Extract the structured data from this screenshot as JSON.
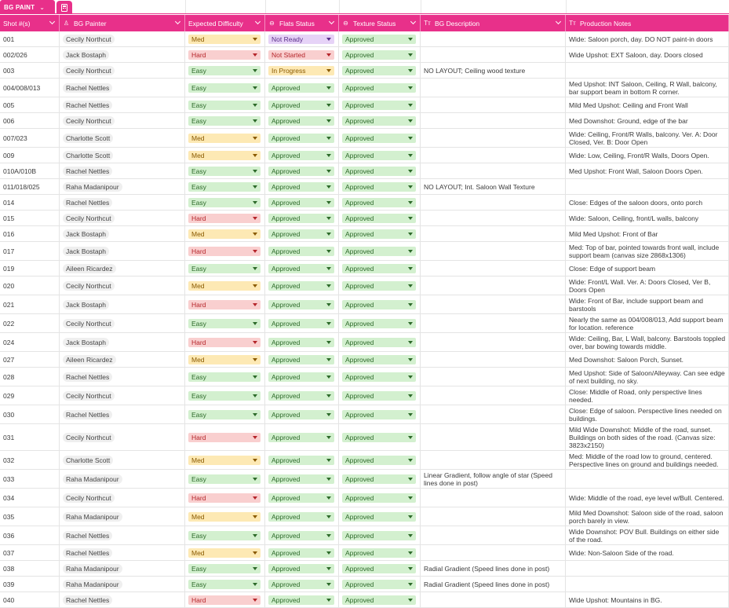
{
  "sheet": {
    "tab_label": "BG PAINT",
    "tab_chevron": "⌄",
    "tab_icon": "calculator-icon"
  },
  "colors": {
    "accent": "#e8308a",
    "easy_bg": "#d3f0cf",
    "easy_fg": "#2d6a2a",
    "med_bg": "#fde9b4",
    "med_fg": "#8a5a00",
    "hard_bg": "#f9cfcf",
    "hard_fg": "#b5252a",
    "approved_bg": "#d3f0cf",
    "approved_fg": "#2d6a2a",
    "notready_bg": "#e6d3f7",
    "notready_fg": "#5a2f8a",
    "notstarted_bg": "#f9cfcf",
    "notstarted_fg": "#b5252a",
    "inprogress_bg": "#fde9b4",
    "inprogress_fg": "#8a5a00"
  },
  "columns": [
    {
      "key": "shot",
      "label": "Shot #(s)",
      "icon": "",
      "icon_name": "",
      "chevron": true
    },
    {
      "key": "painter",
      "label": "BG Painter",
      "icon": "♙",
      "icon_name": "person-icon",
      "chevron": true
    },
    {
      "key": "difficulty",
      "label": "Expected Difficulty",
      "icon": "",
      "icon_name": "",
      "chevron": true
    },
    {
      "key": "flats",
      "label": "Flats Status",
      "icon": "⊖",
      "icon_name": "status-icon",
      "chevron": true
    },
    {
      "key": "texture",
      "label": "Texture Status",
      "icon": "⊖",
      "icon_name": "status-icon",
      "chevron": true
    },
    {
      "key": "desc",
      "label": "BG Description",
      "icon": "Tт",
      "icon_name": "text-icon",
      "chevron": true
    },
    {
      "key": "notes",
      "label": "Production Notes",
      "icon": "Tт",
      "icon_name": "text-icon",
      "chevron": false
    }
  ],
  "rows": [
    {
      "shot": "001",
      "painter": "Cecily Northcut",
      "difficulty": "Med",
      "flats": "Not Ready",
      "texture": "Approved",
      "desc": "",
      "notes": "Wide: Saloon porch, day. DO NOT paint-in doors"
    },
    {
      "shot": "002/026",
      "painter": "Jack Bostaph",
      "difficulty": "Hard",
      "flats": "Not Started",
      "texture": "Approved",
      "desc": "",
      "notes": "Wide Upshot: EXT Saloon, day. Doors closed"
    },
    {
      "shot": "003",
      "painter": "Cecily Northcut",
      "difficulty": "Easy",
      "flats": "In Progress",
      "texture": "Approved",
      "desc": "NO LAYOUT; Ceiling wood texture",
      "notes": ""
    },
    {
      "shot": "004/008/013",
      "painter": "Rachel Nettles",
      "difficulty": "Easy",
      "flats": "Approved",
      "texture": "Approved",
      "desc": "",
      "notes": "Med Upshot: INT Saloon, Ceiling, R Wall, balcony, bar support beam in bottom R corner."
    },
    {
      "shot": "005",
      "painter": "Rachel Nettles",
      "difficulty": "Easy",
      "flats": "Approved",
      "texture": "Approved",
      "desc": "",
      "notes": "Mild Med Upshot: Ceiling and Front Wall"
    },
    {
      "shot": "006",
      "painter": "Cecily Northcut",
      "difficulty": "Easy",
      "flats": "Approved",
      "texture": "Approved",
      "desc": "",
      "notes": "Med Downshot: Ground, edge of the bar"
    },
    {
      "shot": "007/023",
      "painter": "Charlotte Scott",
      "difficulty": "Med",
      "flats": "Approved",
      "texture": "Approved",
      "desc": "",
      "notes": "Wide: Ceiling, Front/R Walls, balcony. Ver. A: Door Closed, Ver. B: Door Open"
    },
    {
      "shot": "009",
      "painter": "Charlotte Scott",
      "difficulty": "Med",
      "flats": "Approved",
      "texture": "Approved",
      "desc": "",
      "notes": "Wide: Low, Ceiling, Front/R Walls, Doors Open."
    },
    {
      "shot": "010A/010B",
      "painter": "Rachel Nettles",
      "difficulty": "Easy",
      "flats": "Approved",
      "texture": "Approved",
      "desc": "",
      "notes": "Med Upshot: Front Wall, Saloon Doors Open."
    },
    {
      "shot": "011/018/025",
      "painter": "Raha Madanipour",
      "difficulty": "Easy",
      "flats": "Approved",
      "texture": "Approved",
      "desc": "NO LAYOUT; Int. Saloon Wall Texture",
      "notes": ""
    },
    {
      "shot": "014",
      "painter": "Rachel Nettles",
      "difficulty": "Easy",
      "flats": "Approved",
      "texture": "Approved",
      "desc": "",
      "notes": "Close: Edges of the saloon doors, onto porch"
    },
    {
      "shot": "015",
      "painter": "Cecily Northcut",
      "difficulty": "Hard",
      "flats": "Approved",
      "texture": "Approved",
      "desc": "",
      "notes": "Wide: Saloon, Ceiling, front/L walls, balcony"
    },
    {
      "shot": "016",
      "painter": "Jack Bostaph",
      "difficulty": "Med",
      "flats": "Approved",
      "texture": "Approved",
      "desc": "",
      "notes": "Mild Med Upshot: Front of Bar"
    },
    {
      "shot": "017",
      "painter": "Jack Bostaph",
      "difficulty": "Hard",
      "flats": "Approved",
      "texture": "Approved",
      "desc": "",
      "notes": "Med: Top of bar, pointed towards front wall, include support beam (canvas size 2868x1306)"
    },
    {
      "shot": "019",
      "painter": "Aileen Ricardez",
      "difficulty": "Easy",
      "flats": "Approved",
      "texture": "Approved",
      "desc": "",
      "notes": "Close: Edge of support beam"
    },
    {
      "shot": "020",
      "painter": "Cecily Northcut",
      "difficulty": "Med",
      "flats": "Approved",
      "texture": "Approved",
      "desc": "",
      "notes": "Wide: Front/L Wall. Ver. A: Doors Closed, Ver B, Doors Open"
    },
    {
      "shot": "021",
      "painter": "Jack Bostaph",
      "difficulty": "Hard",
      "flats": "Approved",
      "texture": "Approved",
      "desc": "",
      "notes": "Wide: Front of Bar, include support beam and barstools"
    },
    {
      "shot": "022",
      "painter": "Cecily Northcut",
      "difficulty": "Easy",
      "flats": "Approved",
      "texture": "Approved",
      "desc": "",
      "notes": "Nearly the same as 004/008/013, Add support beam for location. reference"
    },
    {
      "shot": "024",
      "painter": "Jack Bostaph",
      "difficulty": "Hard",
      "flats": "Approved",
      "texture": "Approved",
      "desc": "",
      "notes": "Wide: Ceiling, Bar, L Wall, balcony. Barstools toppled over, bar bowing towards middle."
    },
    {
      "shot": "027",
      "painter": "Aileen Ricardez",
      "difficulty": "Med",
      "flats": "Approved",
      "texture": "Approved",
      "desc": "",
      "notes": "Med Downshot: Saloon Porch, Sunset."
    },
    {
      "shot": "028",
      "painter": "Rachel Nettles",
      "difficulty": "Easy",
      "flats": "Approved",
      "texture": "Approved",
      "desc": "",
      "notes": "Med Upshot: Side of Saloon/Alleyway. Can see edge of next building, no sky."
    },
    {
      "shot": "029",
      "painter": "Cecily Northcut",
      "difficulty": "Easy",
      "flats": "Approved",
      "texture": "Approved",
      "desc": "",
      "notes": "Close: Middle of Road, only perspective lines needed."
    },
    {
      "shot": "030",
      "painter": "Rachel Nettles",
      "difficulty": "Easy",
      "flats": "Approved",
      "texture": "Approved",
      "desc": "",
      "notes": "Close: Edge of saloon. Perspective lines needed on buildings."
    },
    {
      "shot": "031",
      "painter": "Cecily Northcut",
      "difficulty": "Hard",
      "flats": "Approved",
      "texture": "Approved",
      "desc": "",
      "notes": "Mild Wide Downshot: Middle of the road, sunset. Buildings on both sides of the road. (Canvas size: 3823x2150)"
    },
    {
      "shot": "032",
      "painter": "Charlotte Scott",
      "difficulty": "Med",
      "flats": "Approved",
      "texture": "Approved",
      "desc": "",
      "notes": "Med: Middle of the road low to ground, centered. Perspective lines on ground and buildings needed."
    },
    {
      "shot": "033",
      "painter": "Raha Madanipour",
      "difficulty": "Easy",
      "flats": "Approved",
      "texture": "Approved",
      "desc": "Linear Gradient, follow angle of star (Speed lines done in post)",
      "notes": ""
    },
    {
      "shot": "034",
      "painter": "Cecily Northcut",
      "difficulty": "Hard",
      "flats": "Approved",
      "texture": "Approved",
      "desc": "",
      "notes": "Wide: Middle of the road, eye level w/Bull. Centered."
    },
    {
      "shot": "035",
      "painter": "Raha Madanipour",
      "difficulty": "Med",
      "flats": "Approved",
      "texture": "Approved",
      "desc": "",
      "notes": "Mild Med Downshot: Saloon side of the road, saloon porch barely in view."
    },
    {
      "shot": "036",
      "painter": "Rachel Nettles",
      "difficulty": "Easy",
      "flats": "Approved",
      "texture": "Approved",
      "desc": "",
      "notes": "Wide Downshot: POV Bull. Buildings on either side of the road."
    },
    {
      "shot": "037",
      "painter": "Rachel Nettles",
      "difficulty": "Med",
      "flats": "Approved",
      "texture": "Approved",
      "desc": "",
      "notes": "Wide: Non-Saloon Side of the road."
    },
    {
      "shot": "038",
      "painter": "Raha Madanipour",
      "difficulty": "Easy",
      "flats": "Approved",
      "texture": "Approved",
      "desc": "Radial Gradient (Speed lines done in post)",
      "notes": ""
    },
    {
      "shot": "039",
      "painter": "Raha Madanipour",
      "difficulty": "Easy",
      "flats": "Approved",
      "texture": "Approved",
      "desc": "Radial Gradient (Speed lines done in post)",
      "notes": ""
    },
    {
      "shot": "040",
      "painter": "Rachel Nettles",
      "difficulty": "Hard",
      "flats": "Approved",
      "texture": "Approved",
      "desc": "",
      "notes": "Wide Upshot: Mountains in BG."
    }
  ]
}
